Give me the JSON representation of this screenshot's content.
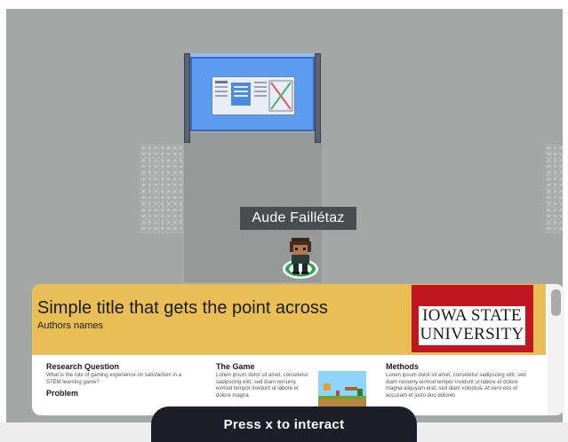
{
  "game": {
    "player_name": "Aude Faillétaz"
  },
  "poster": {
    "title": "Simple title that gets the point across",
    "authors": "Authors names",
    "logo": {
      "line1": "Iowa State",
      "line2": "University"
    },
    "columns": [
      {
        "heading": "Research Question",
        "body": "What is the role of gaming experience on satisfaction in a STEM learning game?",
        "subheading": "Problem"
      },
      {
        "heading": "The Game",
        "body": "Lorem ipsum dolor sit amet, consetetur sadipscing elitr, sed diam nonumy eirmod tempor invidunt ut labore et dolore magna"
      },
      {
        "heading": "Methods",
        "body": "Lorem ipsum dolor sit amet, consetetur sadipscing elitr, sed diam nonumy eirmod tempor invidunt ut labore et dolore magna aliquyam erat, sed diam voluptua. At vero eos et accusam et justo duo dolores"
      }
    ]
  },
  "prompt": {
    "interact_label": "Press x to interact"
  },
  "colors": {
    "floor": "#a3a7a6",
    "poster_header": "#e9be55",
    "logo_red": "#c0161f",
    "board_screen": "#5b9cf0",
    "prompt_bg": "#1c1f2a"
  }
}
